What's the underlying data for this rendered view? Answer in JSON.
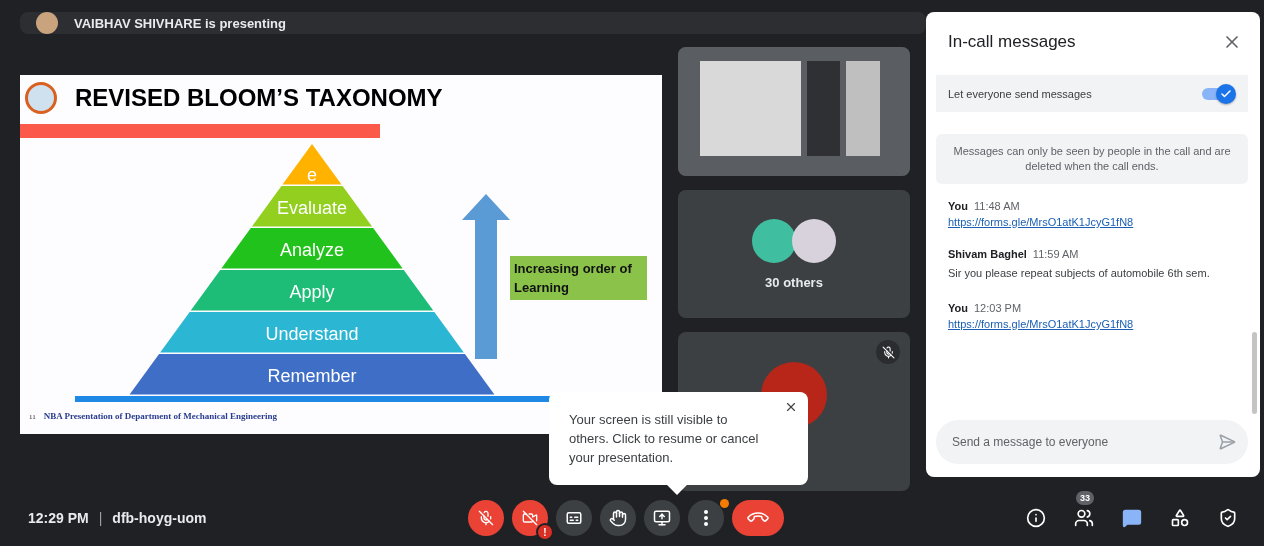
{
  "presenter_banner": {
    "text": "VAIBHAV SHIVHARE is presenting"
  },
  "slide": {
    "title": "REVISED BLOOM’S TAXONOMY",
    "tiers": [
      {
        "label": "e",
        "color": "#ffb300"
      },
      {
        "label": "Evaluate",
        "color": "#92cf1e"
      },
      {
        "label": "Analyze",
        "color": "#22c21c"
      },
      {
        "label": "Apply",
        "color": "#1dbd78"
      },
      {
        "label": "Understand",
        "color": "#2bb6d3"
      },
      {
        "label": "Remember",
        "color": "#3f6ec6"
      }
    ],
    "callout": "Increasing order of Learning",
    "page_number": "11",
    "footer": "NBA Presentation of Department of Mechanical Engineering"
  },
  "tiles": [
    {
      "kind": "screen"
    },
    {
      "kind": "group",
      "label": "30 others"
    },
    {
      "kind": "participant",
      "muted": true
    }
  ],
  "popup": {
    "text": "Your screen is still visible to others. Click to resume or cancel your presentation."
  },
  "chat": {
    "title": "In-call messages",
    "toggle": {
      "label": "Let everyone send messages",
      "on": true
    },
    "notice": "Messages can only be seen by people in the call and are deleted when the call ends.",
    "messages": [
      {
        "sender": "You",
        "time": "11:48 AM",
        "kind": "link",
        "text": "https://forms.gle/MrsO1atK1JcyG1fN8"
      },
      {
        "sender": "Shivam Baghel",
        "time": "11:59 AM",
        "kind": "text",
        "text": "Sir you please repeat subjects of automobile 6th sem."
      },
      {
        "sender": "You",
        "time": "12:03 PM",
        "kind": "link",
        "text": "https://forms.gle/MrsO1atK1JcyG1fN8"
      }
    ],
    "placeholder": "Send a message to everyone"
  },
  "bottom_bar": {
    "time": "12:29 PM",
    "separator": "|",
    "meeting_code": "dfb-hoyg-uom",
    "controls": [
      {
        "kind": "microphone",
        "off": true
      },
      {
        "kind": "camera",
        "off": true,
        "badge": "!"
      },
      {
        "kind": "captions",
        "off": false
      },
      {
        "kind": "raise-hand",
        "off": false
      },
      {
        "kind": "present",
        "off": false
      },
      {
        "kind": "more",
        "off": false,
        "notification": true
      },
      {
        "kind": "leave"
      }
    ],
    "side_buttons": [
      {
        "kind": "info",
        "selected": false
      },
      {
        "kind": "people",
        "selected": false,
        "badge": "33"
      },
      {
        "kind": "chat",
        "selected": true
      },
      {
        "kind": "activities",
        "selected": false
      },
      {
        "kind": "host-controls",
        "selected": false
      }
    ]
  }
}
